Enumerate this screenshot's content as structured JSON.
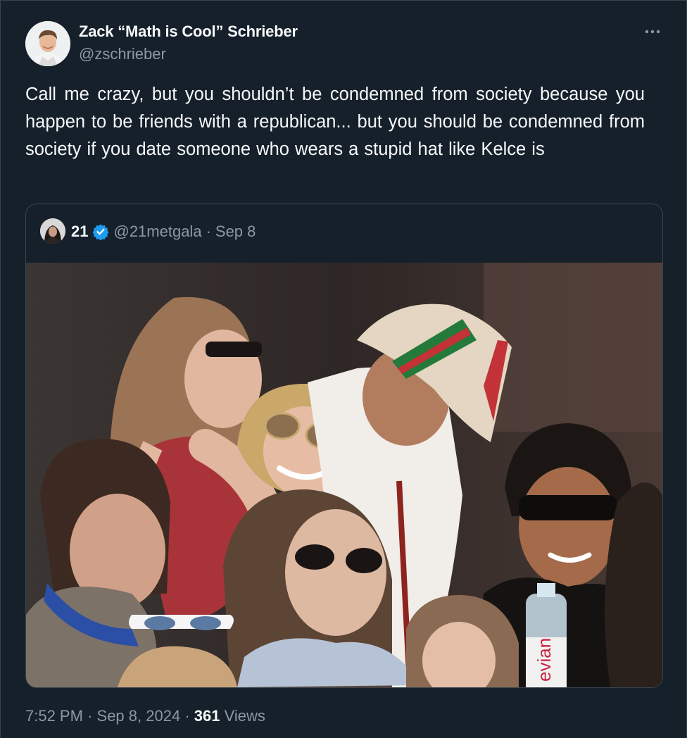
{
  "author": {
    "display_name": "Zack “Math is Cool” Schrieber",
    "handle": "@zschrieber"
  },
  "more_icon": "more-dots-icon",
  "tweet_text": "Call me crazy, but you shouldn’t be condemned from society because you happen to be friends with a republican...  but you should be condemned from society if you date someone who wears  a stupid hat like Kelce is",
  "quoted_tweet": {
    "display_name": "21",
    "verified_icon": "verified-badge-icon",
    "handle": "@21metgala",
    "separator": "·",
    "date": "Sep 8",
    "media_label": "evian"
  },
  "footer": {
    "time": "7:52 PM",
    "sep1": "·",
    "date": "Sep 8, 2024",
    "sep2": "·",
    "views_count": "361",
    "views_label": "Views"
  },
  "colors": {
    "background": "#15202b",
    "border": "#38444d",
    "secondary_text": "#8b98a5",
    "verified": "#1d9bf0"
  }
}
